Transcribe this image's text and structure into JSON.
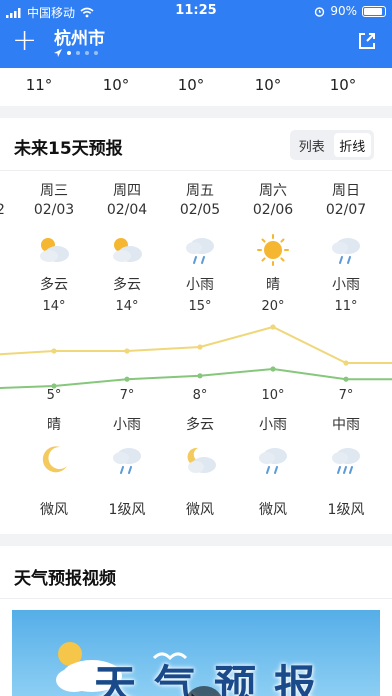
{
  "status_bar": {
    "carrier": "中国移动",
    "time": "11:25",
    "battery": "90%"
  },
  "header": {
    "add_icon": "plus-icon",
    "city": "杭州市",
    "share_icon": "share-icon",
    "page_count": 5,
    "active_page": 1
  },
  "prev_strip": {
    "temps": [
      "11°",
      "10°",
      "10°",
      "10°",
      "10°"
    ]
  },
  "forecast": {
    "title": "未来15天预报",
    "toggle": {
      "list_label": "列表",
      "line_label": "折线",
      "selected": "折线"
    },
    "edge_fragment": "2",
    "days": [
      {
        "weekday": "周三",
        "date": "02/03",
        "day_cond": "多云",
        "day_icon": "partly-cloudy-icon",
        "high": "14°",
        "low": "5°",
        "night_cond": "晴",
        "night_icon": "moon-icon",
        "wind": "微风"
      },
      {
        "weekday": "周四",
        "date": "02/04",
        "day_cond": "多云",
        "day_icon": "partly-cloudy-icon",
        "high": "14°",
        "low": "7°",
        "night_cond": "小雨",
        "night_icon": "light-rain-icon",
        "wind": "1级风"
      },
      {
        "weekday": "周五",
        "date": "02/05",
        "day_cond": "小雨",
        "day_icon": "light-rain-icon",
        "high": "15°",
        "low": "8°",
        "night_cond": "多云",
        "night_icon": "partly-cloudy-night-icon",
        "wind": "微风"
      },
      {
        "weekday": "周六",
        "date": "02/06",
        "day_cond": "晴",
        "day_icon": "sun-icon",
        "high": "20°",
        "low": "10°",
        "night_cond": "小雨",
        "night_icon": "light-rain-icon",
        "wind": "微风"
      },
      {
        "weekday": "周日",
        "date": "02/07",
        "day_cond": "小雨",
        "day_icon": "light-rain-icon",
        "high": "11°",
        "low": "7°",
        "night_cond": "中雨",
        "night_icon": "moderate-rain-icon",
        "wind": "1级风"
      }
    ]
  },
  "chart_data": {
    "type": "line",
    "categories": [
      "02/03",
      "02/04",
      "02/05",
      "02/06",
      "02/07"
    ],
    "series": [
      {
        "values": [
          14,
          14,
          15,
          20,
          11
        ]
      },
      {
        "values": [
          5,
          7,
          8,
          10,
          7
        ]
      }
    ],
    "colors": {
      "high": "#f0d77a",
      "low": "#86c77c"
    }
  },
  "video_card": {
    "title": "天气预报视频",
    "video_title": "天气预报",
    "play_icon": "play-icon"
  },
  "colors": {
    "primary": "#2f7ef3",
    "sun": "#f5b731",
    "cloud": "#dfe7f1",
    "rain": "#5b9bd8",
    "moon": "#f4c95d"
  }
}
